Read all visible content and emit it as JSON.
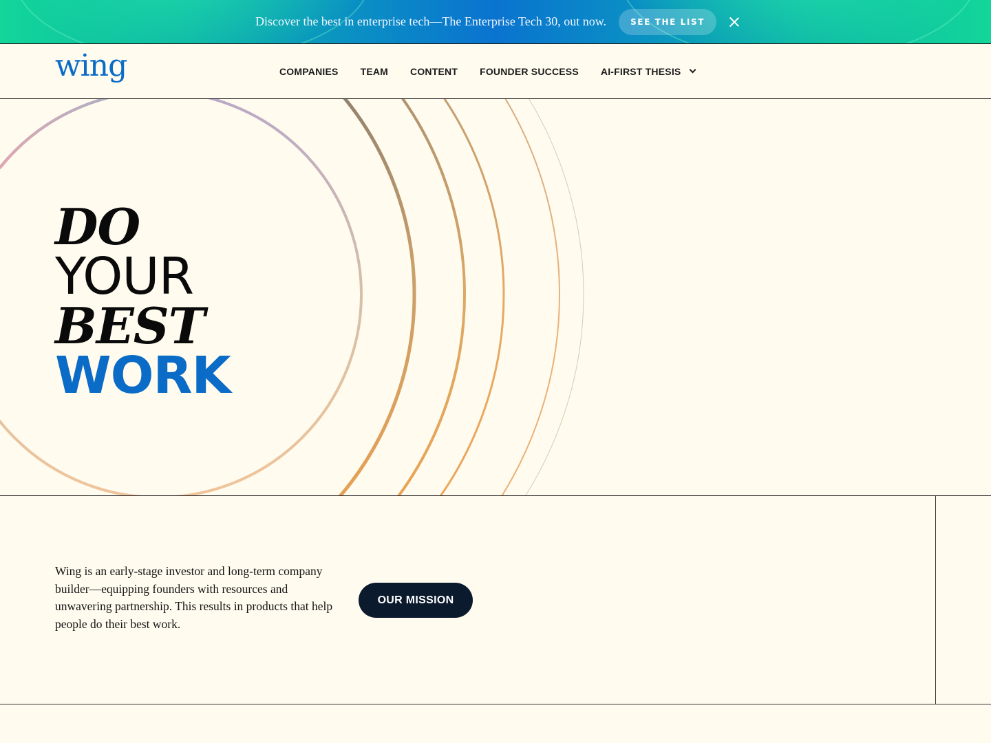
{
  "banner": {
    "message": "Discover the best in enterprise tech—The Enterprise Tech 30, out now.",
    "cta_label": "SEE THE LIST",
    "close_icon": "close-icon"
  },
  "header": {
    "logo_text": "wing",
    "nav": [
      {
        "label": "COMPANIES"
      },
      {
        "label": "TEAM"
      },
      {
        "label": "CONTENT"
      },
      {
        "label": "FOUNDER SUCCESS"
      },
      {
        "label": "AI-FIRST THESIS",
        "icon": "chevron-down-icon"
      }
    ]
  },
  "hero": {
    "line1": "DO",
    "line2": "YOUR",
    "line3": "BEST",
    "line4": "WORK"
  },
  "about": {
    "description": "Wing is an early-stage investor and long-term company builder—equipping founders with resources and unwavering partnership. This results in products that help people do their best work.",
    "cta_label": "OUR MISSION"
  },
  "colors": {
    "brand_blue": "#0a6cc7",
    "background": "#fffbef",
    "button_dark": "#0c1a2e"
  }
}
